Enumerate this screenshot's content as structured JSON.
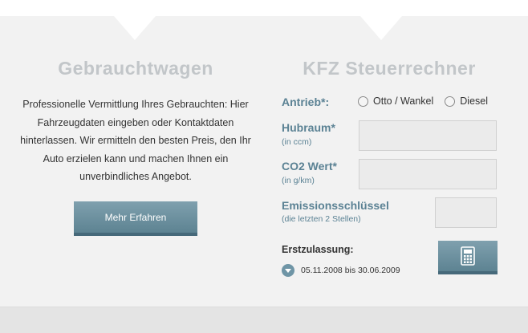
{
  "left_section": {
    "title": "Gebrauchtwagen",
    "description": "Professionelle Vermittlung Ihres Gebrauchten: Hier Fahrzeugdaten eingeben oder Kontaktdaten hinterlassen. Wir ermitteln den besten Preis, den Ihr Auto erzielen kann und machen Ihnen ein unverbindliches Angebot.",
    "button_label": "Mehr Erfahren"
  },
  "right_section": {
    "title": "KFZ Steuerrechner",
    "antrieb": {
      "label": "Antrieb*:",
      "options": [
        "Otto / Wankel",
        "Diesel"
      ]
    },
    "hubraum": {
      "label": "Hubraum*",
      "sublabel": "(in ccm)",
      "value": ""
    },
    "co2": {
      "label": "CO2 Wert*",
      "sublabel": "(in g/km)",
      "value": ""
    },
    "emission": {
      "label": "Emissionsschlüssel",
      "sublabel": "(die letzten 2 Stellen)",
      "value": ""
    },
    "erstzulassung": {
      "label": "Erstzulassung:",
      "selected": "05.11.2008 bis 30.06.2009"
    },
    "calc_button_icon": "calculator-icon"
  },
  "colors": {
    "accent": "#5b8294",
    "button": "#6a8f9f",
    "title": "#c2c6c9"
  }
}
